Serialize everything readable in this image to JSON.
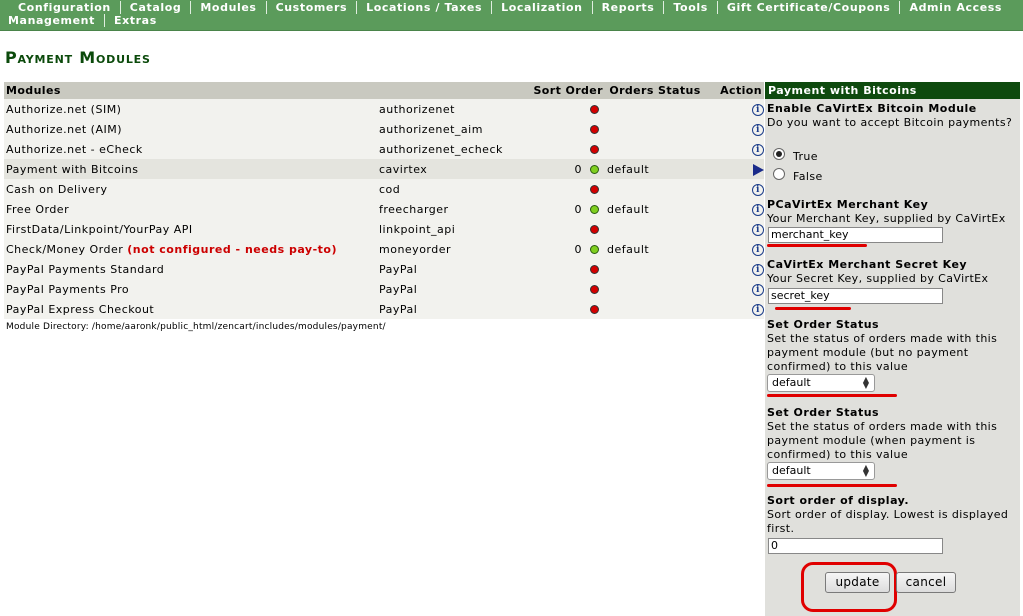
{
  "nav": {
    "row1": [
      "Configuration",
      "Catalog",
      "Modules",
      "Customers",
      "Locations / Taxes",
      "Localization",
      "Reports",
      "Tools",
      "Gift Certificate/Coupons",
      "Admin Access"
    ],
    "row2": [
      "Management",
      "Extras"
    ]
  },
  "page_title": "Payment Modules",
  "table": {
    "headers": {
      "modules": "Modules",
      "sort_order": "Sort Order",
      "orders_status": "Orders Status",
      "action": "Action"
    },
    "rows": [
      {
        "name": "Authorize.net (SIM)",
        "code": "authorizenet",
        "sort": "",
        "status_color": "red",
        "orders_status": "",
        "action": "info-icon"
      },
      {
        "name": "Authorize.net (AIM)",
        "code": "authorizenet_aim",
        "sort": "",
        "status_color": "red",
        "orders_status": "",
        "action": "info-icon"
      },
      {
        "name": "Authorize.net - eCheck",
        "code": "authorizenet_echeck",
        "sort": "",
        "status_color": "red",
        "orders_status": "",
        "action": "info-icon"
      },
      {
        "name": "Payment with Bitcoins",
        "code": "cavirtex",
        "sort": "0",
        "status_color": "green",
        "orders_status": "default",
        "action": "arrow-icon",
        "selected": true
      },
      {
        "name": "Cash on Delivery",
        "code": "cod",
        "sort": "",
        "status_color": "red",
        "orders_status": "",
        "action": "info-icon"
      },
      {
        "name": "Free Order",
        "code": "freecharger",
        "sort": "0",
        "status_color": "green",
        "orders_status": "default",
        "action": "info-icon"
      },
      {
        "name": "FirstData/Linkpoint/YourPay API",
        "code": "linkpoint_api",
        "sort": "",
        "status_color": "red",
        "orders_status": "",
        "action": "info-icon"
      },
      {
        "name": "Check/Money Order",
        "warning": "(not configured - needs pay-to)",
        "code": "moneyorder",
        "sort": "0",
        "status_color": "green",
        "orders_status": "default",
        "action": "info-icon"
      },
      {
        "name": "PayPal Payments Standard",
        "code": "PayPal",
        "sort": "",
        "status_color": "red",
        "orders_status": "",
        "action": "info-icon"
      },
      {
        "name": "PayPal Payments Pro",
        "code": "PayPal",
        "sort": "",
        "status_color": "red",
        "orders_status": "",
        "action": "info-icon"
      },
      {
        "name": "PayPal Express Checkout",
        "code": "PayPal",
        "sort": "",
        "status_color": "red",
        "orders_status": "",
        "action": "info-icon"
      }
    ],
    "module_directory": "Module Directory: /home/aaronk/public_html/zencart/includes/modules/payment/"
  },
  "panel": {
    "header": "Payment with Bitcoins",
    "enable": {
      "title": "Enable CaVirtEx Bitcoin Module",
      "desc": "Do you want to accept Bitcoin payments?",
      "options": [
        "True",
        "False"
      ],
      "selected": "True"
    },
    "merchant_key": {
      "title": "PCaVirtEx Merchant Key",
      "desc": "Your Merchant Key, supplied by CaVirtEx",
      "value": "merchant_key"
    },
    "secret_key": {
      "title": "CaVirtEx Merchant Secret Key",
      "desc": "Your Secret Key, supplied by CaVirtEx",
      "value": "secret_key"
    },
    "order_status_unconfirmed": {
      "title": "Set Order Status",
      "desc_lines": [
        "Set the status of orders made with this",
        "payment module (but no payment",
        "confirmed) to this value"
      ],
      "value": "default"
    },
    "order_status_confirmed": {
      "title": "Set Order Status",
      "desc_lines": [
        "Set the status of orders made with this",
        "payment module (when payment is",
        "confirmed) to this value"
      ],
      "value": "default"
    },
    "sort_order": {
      "title": "Sort order of display.",
      "desc_lines": [
        "Sort order of display. Lowest is displayed",
        "first."
      ],
      "value": "0"
    },
    "buttons": {
      "update": "update",
      "cancel": "cancel"
    }
  },
  "colors": {
    "nav_bg": "#5b9b5b",
    "title_green": "#0b4a0b",
    "panel_header_bg": "#0e4a0e",
    "annotation_red": "#e00000"
  }
}
